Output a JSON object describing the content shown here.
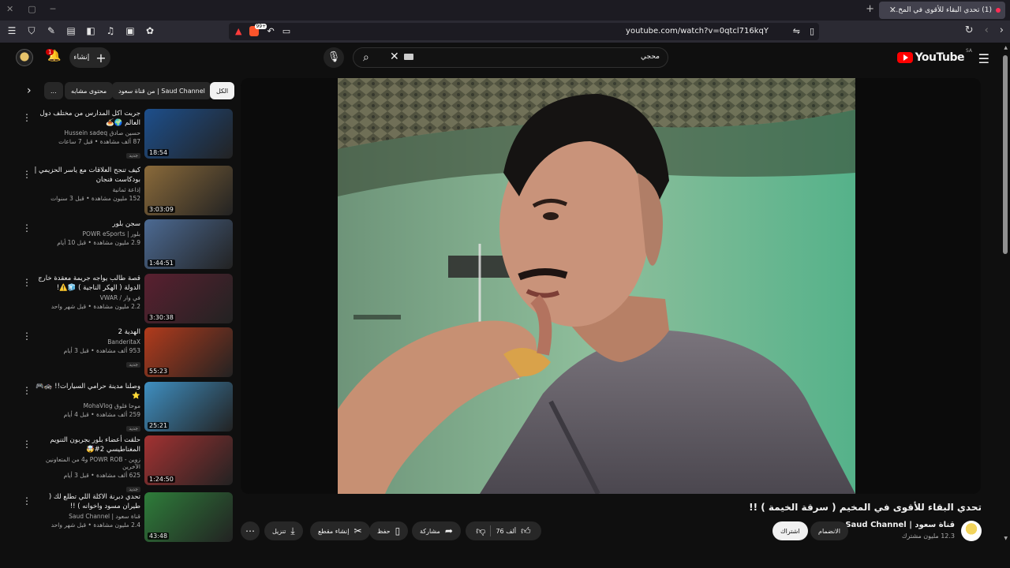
{
  "browser": {
    "tab_title": "(1) تحدي البقاء للأقوى في المخ...",
    "url": "youtube.com/watch?v=0qtcl716kqY",
    "brave_badge": "99+"
  },
  "header": {
    "logo_text": "YouTube",
    "country_code": "SA",
    "search_value": "محجي",
    "create_label": "إنشاء",
    "notification_count": "1"
  },
  "chips": [
    {
      "label": "الكل",
      "active": true
    },
    {
      "label": "من قناة سعود | Saud Channel",
      "active": false
    },
    {
      "label": "محتوى مشابه",
      "active": false
    },
    {
      "label": "...",
      "active": false
    }
  ],
  "related": [
    {
      "title": "جربت اكل المدارس من مختلف دول العالم 🌍🍝",
      "channel": "حسين صادق Hussein sadeq",
      "stats": "87 ألف مشاهدة • قبل 7 ساعات",
      "badge": "جديد",
      "duration": "18:54",
      "thumb": "#1d4f8c"
    },
    {
      "title": "كيف تنجح العلاقات مع ياسر الحزيمي | بودكاست فنجان",
      "channel": "إذاعة ثمانية",
      "stats": "152 مليون مشاهدة • قبل 3 سنوات",
      "badge": "",
      "duration": "3:03:09",
      "thumb": "#8a6a3a"
    },
    {
      "title": "سجن بلور",
      "channel": "بلور | POWR eSports",
      "stats": "2.9 مليون مشاهدة • قبل 10 أيام",
      "badge": "",
      "duration": "1:44:51",
      "thumb": "#4c6a93"
    },
    {
      "title": "قصة طالب يواجه جريمة معقدة خارج الدولة ( الهكر الناجية ) 🧊⚠️!",
      "channel": "في وار / VWAR",
      "stats": "2.2 مليون مشاهدة • قبل شهر واحد",
      "badge": "",
      "duration": "3:30:38",
      "thumb": "#5a2030"
    },
    {
      "title": "الهدية 2",
      "channel": "BanderitaX",
      "stats": "953 ألف مشاهدة • قبل 3 أيام",
      "badge": "جديد",
      "duration": "55:23",
      "thumb": "#b23b1c"
    },
    {
      "title": "وصلنا مدينة حرامي السيارات!! 🚓🎮⭐",
      "channel": "موحا فلوق MohaVlog",
      "stats": "259 ألف مشاهدة • قبل 4 أيام",
      "badge": "جديد",
      "duration": "25:21",
      "thumb": "#3f8fc1"
    },
    {
      "title": "حلقت أعضاء بلور بجربون التنويم المغناطيسي 2#🤯",
      "channel": "زوين - POWR ROB و4 من المتعاونين الآخرين",
      "stats": "625 ألف مشاهدة • قبل 3 أيام",
      "badge": "جديد",
      "duration": "1:24:50",
      "thumb": "#a33232"
    },
    {
      "title": "تحدي دبرنة الاكلة اللي تطلع لك ( طيران مسود واخوانه ) !!",
      "channel": "قناة سعود | Saud Channel",
      "stats": "2.4 مليون مشاهدة • قبل شهر واحد",
      "badge": "",
      "duration": "43:48",
      "thumb": "#2e7d3a"
    }
  ],
  "video": {
    "title": "تحدي البقاء للأقوى في المخيم ( سرقة الخيمة ) !!",
    "channel_name": "قناة سعود | Saud Channel",
    "subscribers": "12.3 مليون مشترك",
    "join_label": "الانضمام",
    "subscribe_label": "اشتراك",
    "likes": "76 ألف",
    "share_label": "مشاركة",
    "save_label": "حفظ",
    "clip_label": "إنشاء مقطع",
    "download_label": "تنزيل"
  }
}
